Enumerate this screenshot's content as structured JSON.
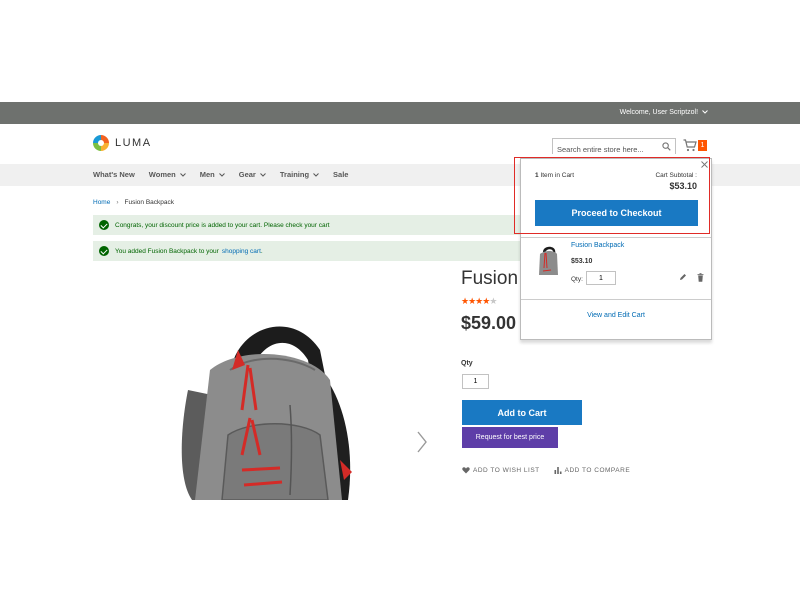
{
  "topbar": {
    "welcome": "Welcome, User Scriptzol!",
    "chevron": "⌄"
  },
  "header": {
    "logo_text": "LUMA",
    "search_placeholder": "Search entire store here...",
    "cart_count": "1"
  },
  "nav": {
    "items": [
      "What's New",
      "Women",
      "Men",
      "Gear",
      "Training",
      "Sale"
    ]
  },
  "breadcrumb": {
    "home": "Home",
    "separator": "›",
    "current": "Fusion Backpack"
  },
  "messages": {
    "discount": "Congrats, your discount price is added to your cart. Please check your cart",
    "added_prefix": "You added Fusion Backpack to your",
    "added_link": "shopping cart",
    "added_suffix": "."
  },
  "product": {
    "title": "Fusion Backpack",
    "rating_stars": 3.5,
    "price": "$59.00",
    "qty_label": "Qty",
    "qty_value": "1",
    "add_to_cart": "Add to Cart",
    "best_price": "Request for best price",
    "wishlist": "ADD TO WISH LIST",
    "compare": "ADD TO COMPARE"
  },
  "minicart": {
    "items_count": "1",
    "items_label": "Item in Cart",
    "subtotal_label": "Cart Subtotal :",
    "subtotal_value": "$53.10",
    "checkout": "Proceed to Checkout",
    "item_name": "Fusion Backpack",
    "item_price": "$53.10",
    "qty_label": "Qty:",
    "qty_value": "1",
    "view_edit": "View and Edit Cart"
  },
  "colors": {
    "topbar": "#6e716e",
    "primary_button": "#1979c3",
    "best_price_button": "#5e3ea8",
    "badge": "#ff5501",
    "link": "#006bb4",
    "highlight": "#e02b27"
  }
}
